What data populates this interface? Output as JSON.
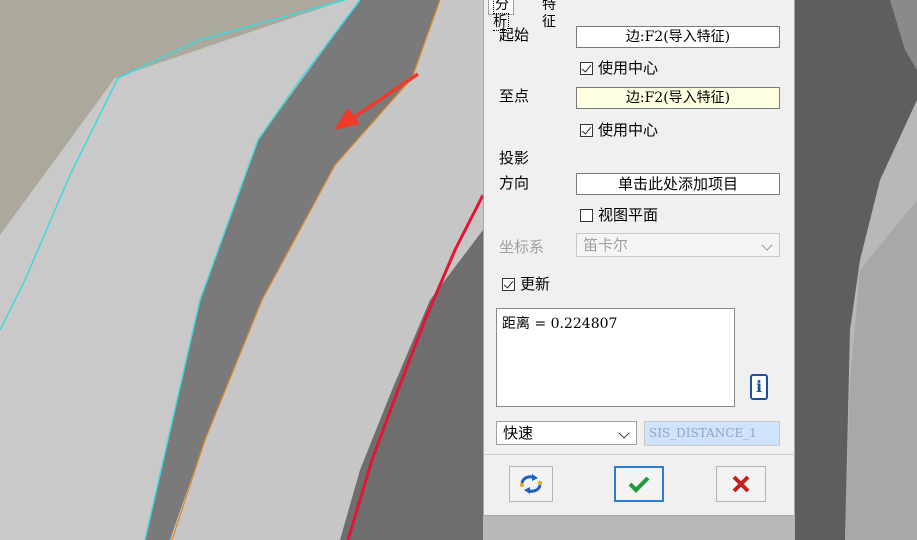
{
  "dialog": {
    "tabs": [
      {
        "label": "分析",
        "active": true
      },
      {
        "label": "特征",
        "active": false
      }
    ],
    "from_label": "起始",
    "from_value": "边:F2(导入特征)",
    "from_use_center_label": "使用中心",
    "from_use_center": true,
    "to_label": "至点",
    "to_value": "边:F2(导入特征)",
    "to_use_center_label": "使用中心",
    "to_use_center": true,
    "projection_label": "投影",
    "direction_label": "方向",
    "direction_value": "单击此处添加项目",
    "view_plane_label": "视图平面",
    "view_plane": false,
    "coord_label": "坐标系",
    "coord_value": "笛卡尔",
    "update_label": "更新",
    "update": true,
    "result_label": "距离",
    "result_text": " = 0.224807",
    "mode_value": "快速",
    "feature_name": "SIS_DISTANCE_1"
  },
  "colors": {
    "accent_blue": "#2c7ad6",
    "ok_green": "#1f9a3a",
    "cancel_red": "#d32020",
    "edge_cyan": "#3fd8e0",
    "edge_orange": "#e08a2a",
    "edge_red": "#e21535",
    "arrow_red": "#ee3a2a"
  },
  "icons": [
    "info-icon",
    "regenerate-icon",
    "ok-check-icon",
    "cancel-x-icon",
    "chevron-down-icon",
    "red-arrow-annotation"
  ]
}
